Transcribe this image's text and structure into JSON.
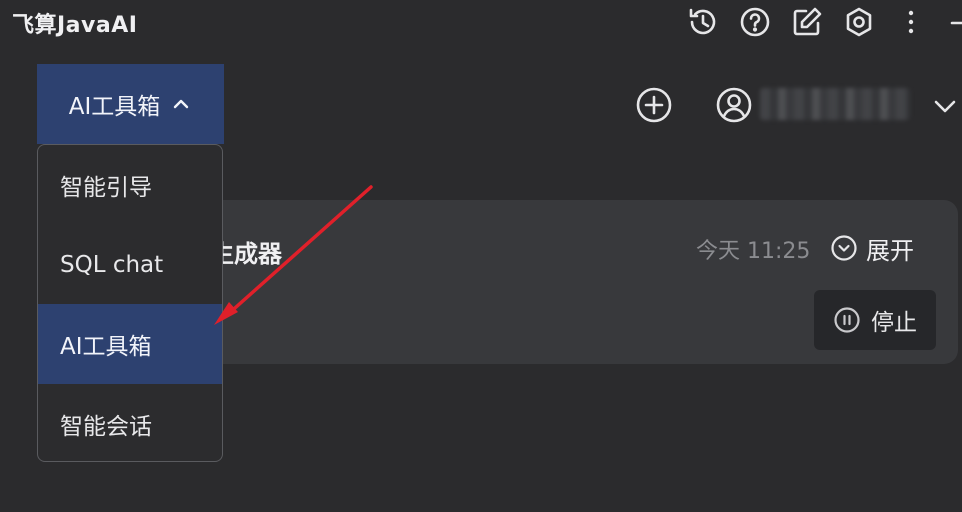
{
  "app": {
    "title": "飞算JavaAI"
  },
  "toolbar": {
    "icons": [
      "history-icon",
      "help-icon",
      "edit-icon",
      "settings-icon",
      "more-icon",
      "minimize-icon"
    ]
  },
  "toolbox": {
    "label": "AI工具箱"
  },
  "menu": {
    "items": [
      {
        "label": "智能引导",
        "selected": false
      },
      {
        "label": "SQL chat",
        "selected": false
      },
      {
        "label": "AI工具箱",
        "selected": true
      },
      {
        "label": "智能会话",
        "selected": false
      }
    ]
  },
  "card": {
    "title_visible": "生成器",
    "time": "今天 11:25",
    "expand_label": "展开",
    "stop_label": "停止"
  },
  "colors": {
    "background": "#2b2b2d",
    "selected": "#2d4170",
    "annotation_arrow": "#e0202a"
  }
}
